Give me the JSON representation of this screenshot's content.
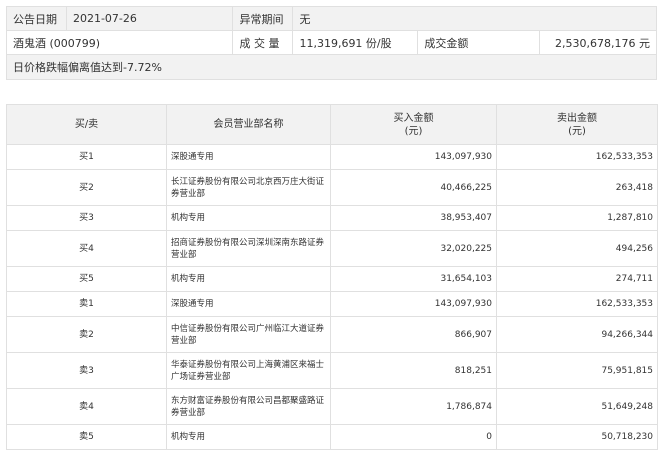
{
  "info": {
    "date_label": "公告日期",
    "date": "2021-07-26",
    "period_label": "异常期间",
    "period": "无",
    "stock": "酒鬼酒 (000799)",
    "volume_label": "成 交 量",
    "volume": "11,319,691 份/股",
    "amount_label": "成交金额",
    "amount": "2,530,678,176 元",
    "reason": "日价格跌幅偏离值达到-7.72%"
  },
  "table": {
    "headers": {
      "side": "买/卖",
      "dept": "会员营业部名称",
      "buy": "买入金额\n(元)",
      "sell": "卖出金额\n(元)"
    },
    "rows": [
      {
        "side": "买1",
        "dept": "深股通专用",
        "buy": "143,097,930",
        "sell": "162,533,353"
      },
      {
        "side": "买2",
        "dept": "长江证券股份有限公司北京西万庄大街证券营业部",
        "buy": "40,466,225",
        "sell": "263,418"
      },
      {
        "side": "买3",
        "dept": "机构专用",
        "buy": "38,953,407",
        "sell": "1,287,810"
      },
      {
        "side": "买4",
        "dept": "招商证券股份有限公司深圳深南东路证券营业部",
        "buy": "32,020,225",
        "sell": "494,256"
      },
      {
        "side": "买5",
        "dept": "机构专用",
        "buy": "31,654,103",
        "sell": "274,711"
      },
      {
        "side": "卖1",
        "dept": "深股通专用",
        "buy": "143,097,930",
        "sell": "162,533,353"
      },
      {
        "side": "卖2",
        "dept": "中信证券股份有限公司广州临江大道证券营业部",
        "buy": "866,907",
        "sell": "94,266,344"
      },
      {
        "side": "卖3",
        "dept": "华泰证券股份有限公司上海黄浦区来福士广场证券营业部",
        "buy": "818,251",
        "sell": "75,951,815"
      },
      {
        "side": "卖4",
        "dept": "东方财富证券股份有限公司昌都聚盛路证券营业部",
        "buy": "1,786,874",
        "sell": "51,649,248"
      },
      {
        "side": "卖5",
        "dept": "机构专用",
        "buy": "0",
        "sell": "50,718,230"
      }
    ]
  }
}
